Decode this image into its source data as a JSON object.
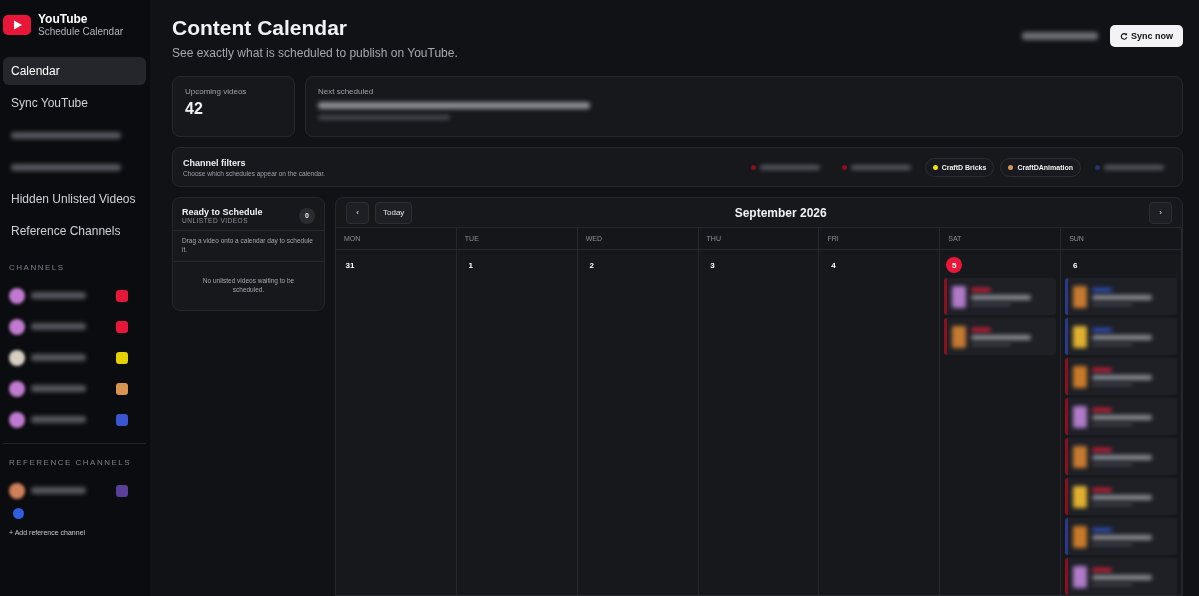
{
  "brand": {
    "title": "YouTube",
    "subtitle": "Schedule Calendar"
  },
  "nav": [
    {
      "kind": "label",
      "label": "Calendar",
      "selected": true
    },
    {
      "kind": "label",
      "label": "Sync YouTube",
      "selected": false
    },
    {
      "kind": "blurred",
      "selected": false
    },
    {
      "kind": "blurred",
      "selected": false
    },
    {
      "kind": "label",
      "label": "Hidden Unlisted Videos",
      "selected": false
    },
    {
      "kind": "label",
      "label": "Reference Channels",
      "selected": false
    }
  ],
  "channels_heading": "CHANNELS",
  "channels": [
    {
      "color": "#e8173a"
    },
    {
      "color": "#e8173a"
    },
    {
      "color": "#e6d000"
    },
    {
      "color": "#d9944f"
    },
    {
      "color": "#3a55d0"
    }
  ],
  "reference_heading": "REFERENCE CHANNELS",
  "reference_channels": [
    {
      "color": "#5a3f9a"
    }
  ],
  "add_reference": "+ Add reference channel",
  "header": {
    "title": "Content Calendar",
    "subtitle": "See exactly what is scheduled to publish on YouTube.",
    "sync_button": "Sync now"
  },
  "stats": {
    "upcoming_label": "Upcoming videos",
    "upcoming_value": "42",
    "next_label": "Next scheduled"
  },
  "filters": {
    "title": "Channel filters",
    "subtitle": "Choose which schedules appear on the calendar.",
    "chips": [
      {
        "kind": "blurred",
        "color": "#8a1020"
      },
      {
        "kind": "blurred",
        "color": "#8a1020"
      },
      {
        "kind": "named",
        "label": "CraftD Bricks",
        "color": "#f2e20c"
      },
      {
        "kind": "named",
        "label": "CraftDAnimation",
        "color": "#d9944f"
      },
      {
        "kind": "blurred",
        "color": "#27326e"
      }
    ]
  },
  "ready": {
    "title": "Ready to Schedule",
    "subtitle": "UNLISTED VIDEOS",
    "count": "0",
    "hint": "Drag a video onto a calendar day to schedule it.",
    "empty": "No unlisted videos waiting to be scheduled."
  },
  "calendar": {
    "prev": "‹",
    "today": "Today",
    "month": "September 2026",
    "next": "›",
    "weekdays": [
      "MON",
      "TUE",
      "WED",
      "THU",
      "FRI",
      "SAT",
      "SUN"
    ],
    "days": [
      {
        "date": "31",
        "today": false
      },
      {
        "date": "1",
        "today": false
      },
      {
        "date": "2",
        "today": false
      },
      {
        "date": "3",
        "today": false
      },
      {
        "date": "4",
        "today": false
      },
      {
        "date": "5",
        "today": true,
        "events": [
          {
            "color": "#8a1020"
          },
          {
            "color": "#8a1020"
          }
        ]
      },
      {
        "date": "6",
        "today": false,
        "events": [
          {
            "color": "#2a3a8a"
          },
          {
            "color": "#2a3a8a"
          },
          {
            "color": "#8a1020"
          },
          {
            "color": "#8a1020"
          },
          {
            "color": "#8a1020"
          },
          {
            "color": "#8a1020"
          },
          {
            "color": "#2a3a8a"
          },
          {
            "color": "#8a1020"
          }
        ]
      }
    ]
  }
}
